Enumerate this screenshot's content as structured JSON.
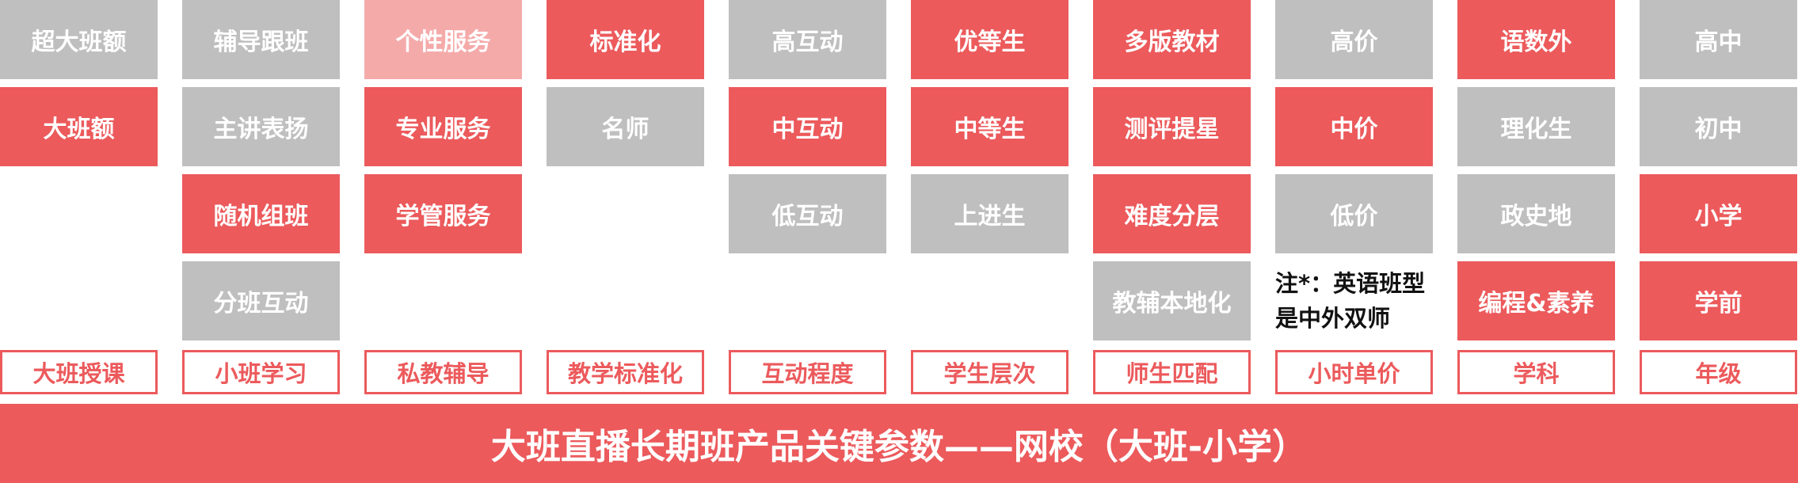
{
  "banner_title": "大班直播长期班产品关键参数——网校（大班-小学）",
  "colors": {
    "highlight": "#ec5a5c",
    "muted": "#bfbfbf",
    "light_highlight": "#f5aaaa",
    "text_light": "#ffffff",
    "text_dark": "#111111"
  },
  "columns": [
    {
      "label": "大班授课",
      "options": [
        {
          "text": "超大班额",
          "state": "gray"
        },
        {
          "text": "大班额",
          "state": "red"
        }
      ]
    },
    {
      "label": "小班学习",
      "options": [
        {
          "text": "辅导跟班",
          "state": "gray"
        },
        {
          "text": "主讲表扬",
          "state": "gray"
        },
        {
          "text": "随机组班",
          "state": "red"
        },
        {
          "text": "分班互动",
          "state": "gray"
        }
      ]
    },
    {
      "label": "私教辅导",
      "options": [
        {
          "text": "个性服务",
          "state": "pink"
        },
        {
          "text": "专业服务",
          "state": "red"
        },
        {
          "text": "学管服务",
          "state": "red"
        }
      ]
    },
    {
      "label": "教学标准化",
      "options": [
        {
          "text": "标准化",
          "state": "red"
        },
        {
          "text": "名师",
          "state": "gray"
        }
      ]
    },
    {
      "label": "互动程度",
      "options": [
        {
          "text": "高互动",
          "state": "gray"
        },
        {
          "text": "中互动",
          "state": "red"
        },
        {
          "text": "低互动",
          "state": "gray"
        }
      ]
    },
    {
      "label": "学生层次",
      "options": [
        {
          "text": "优等生",
          "state": "red"
        },
        {
          "text": "中等生",
          "state": "red"
        },
        {
          "text": "上进生",
          "state": "gray"
        }
      ]
    },
    {
      "label": "师生匹配",
      "options": [
        {
          "text": "多版教材",
          "state": "red"
        },
        {
          "text": "测评提星",
          "state": "red"
        },
        {
          "text": "难度分层",
          "state": "red"
        },
        {
          "text": "教辅本地化",
          "state": "gray"
        }
      ]
    },
    {
      "label": "小时单价",
      "options": [
        {
          "text": "高价",
          "state": "gray"
        },
        {
          "text": "中价",
          "state": "red"
        },
        {
          "text": "低价",
          "state": "gray"
        }
      ],
      "note_lines": [
        "注*：英语班型",
        "是中外双师"
      ]
    },
    {
      "label": "学科",
      "options": [
        {
          "text": "语数外",
          "state": "red"
        },
        {
          "text": "理化生",
          "state": "gray"
        },
        {
          "text": "政史地",
          "state": "gray"
        },
        {
          "text": "编程&素养",
          "state": "red"
        }
      ]
    },
    {
      "label": "年级",
      "options": [
        {
          "text": "高中",
          "state": "gray"
        },
        {
          "text": "初中",
          "state": "gray"
        },
        {
          "text": "小学",
          "state": "red"
        },
        {
          "text": "学前",
          "state": "red"
        }
      ]
    }
  ]
}
